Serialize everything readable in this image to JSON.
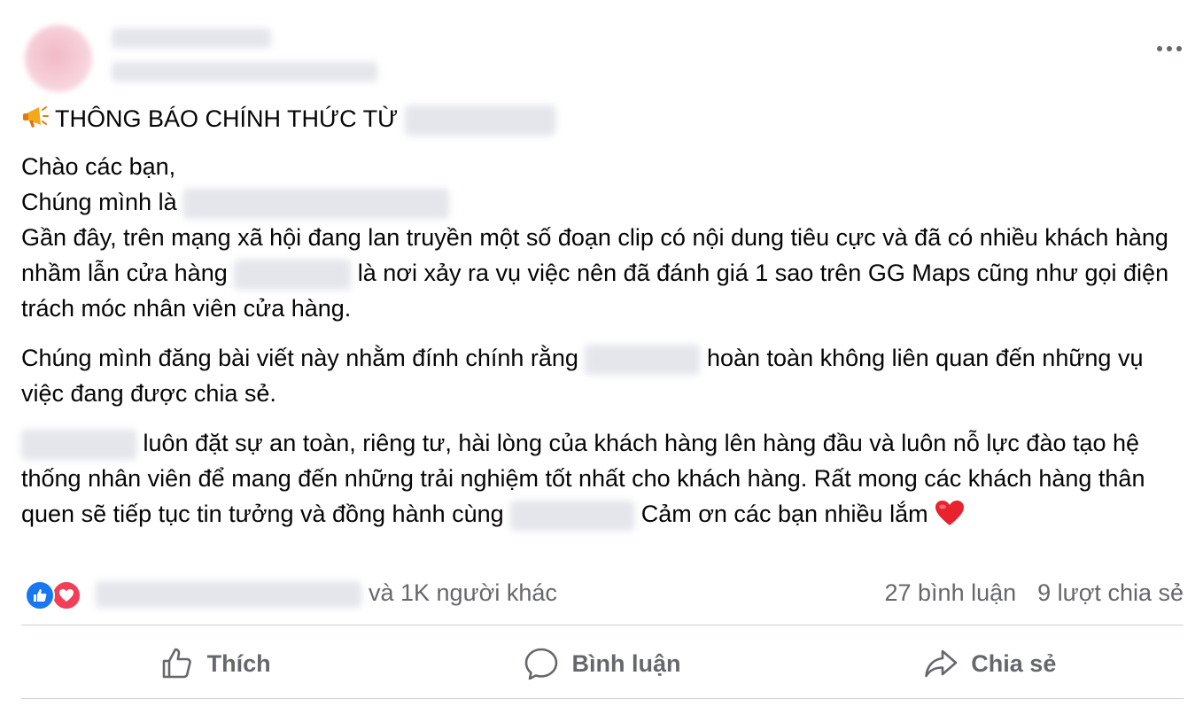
{
  "post": {
    "headline_prefix": "THÔNG BÁO CHÍNH THỨC TỪ",
    "greeting": "Chào các bạn,",
    "intro": "Chúng mình là",
    "p1_a": "Gần đây, trên mạng xã hội đang lan truyền một số đoạn clip có nội dung tiêu cực và đã có nhiều khách hàng nhầm lẫn cửa hàng",
    "p1_b": "là nơi xảy ra vụ việc nên đã đánh giá 1 sao trên GG Maps cũng như gọi điện trách móc nhân viên cửa hàng.",
    "p2_a": "Chúng mình đăng bài viết này nhằm đính chính rằng",
    "p2_b": "hoàn toàn không liên quan đến những vụ việc đang được chia sẻ.",
    "p3_a": "luôn đặt sự an toàn, riêng tư, hài lòng của khách hàng lên hàng đầu và luôn nỗ lực đào tạo hệ thống nhân viên để mang đến những trải nghiệm tốt nhất cho khách hàng. Rất mong các khách hàng thân quen sẽ tiếp tục tin tưởng và đồng hành cùng",
    "p3_b": "Cảm ơn các bạn nhiều lắm"
  },
  "reactions": {
    "others": "và 1K người khác",
    "comments": "27 bình luận",
    "shares": "9 lượt chia sẻ"
  },
  "actions": {
    "like": "Thích",
    "comment": "Bình luận",
    "share": "Chia sẻ"
  },
  "icons": [
    "megaphone-icon",
    "heart-emoji-icon",
    "like-reaction-icon",
    "love-reaction-icon",
    "thumbs-up-icon",
    "comment-bubble-icon",
    "share-arrow-icon",
    "more-options-icon"
  ],
  "colors": {
    "like_blue": "#1877f2",
    "love_red": "#f33e58",
    "muted_text": "#65676b"
  }
}
